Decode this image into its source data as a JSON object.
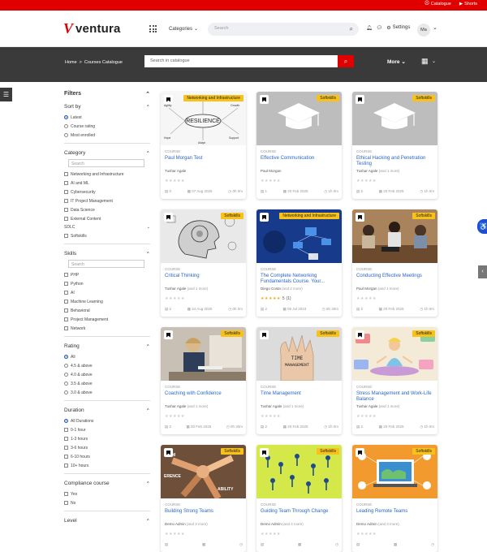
{
  "top_links": {
    "catalogue": "Catalogue",
    "shorts": "Shorts"
  },
  "header": {
    "logo": "ventura",
    "categories": "Categories",
    "search_placeholder": "Search",
    "settings": "Settings",
    "avatar": "Ma"
  },
  "bar": {
    "breadcrumb_home": "Home",
    "breadcrumb_sep": ">",
    "breadcrumb_current": "Courses Catalogue",
    "search_placeholder": "Search in catalogue",
    "more": "More"
  },
  "filters": {
    "title": "Filters",
    "sort": {
      "title": "Sort by",
      "options": [
        "Latest",
        "Course rating",
        "Most enrolled"
      ]
    },
    "category": {
      "title": "Category",
      "placeholder": "Search",
      "options": [
        "Networking and Infrastructure",
        "AI and ML",
        "Cybersecurity",
        "IT Project Management",
        "Data Science",
        "External Content"
      ],
      "sub": "SDLC",
      "sub_options": [
        "Softskills"
      ]
    },
    "skills": {
      "title": "Skills",
      "placeholder": "Search",
      "options": [
        "PHP",
        "Python",
        "AI",
        "Machine Learning",
        "Behavioral",
        "Project Management",
        "Network"
      ]
    },
    "rating": {
      "title": "Rating",
      "options": [
        "All",
        "4.5 & above",
        "4.0 & above",
        "3.5 & above",
        "3.0 & above"
      ]
    },
    "duration": {
      "title": "Duration",
      "options": [
        "All Durations",
        "0-1 hour",
        "1-3 hours",
        "3-6 hours",
        "6-10 hours",
        "10+ hours"
      ]
    },
    "compliance": {
      "title": "Compliance course",
      "options": [
        "Yes",
        "No"
      ]
    },
    "level": {
      "title": "Level"
    }
  },
  "cards": [
    {
      "badge": "Networking and Infrastructure",
      "type": "COURSE",
      "title": "Paul Morgan Test",
      "author": "Tushar Agale",
      "more": "",
      "rating": "",
      "students": "0",
      "date": "07 Aug 2025",
      "duration": "0h 0m",
      "thumb": "resilience"
    },
    {
      "badge": "Softskills",
      "type": "COURSE",
      "title": "Effective Communication",
      "author": "Paul Morgan",
      "more": "",
      "rating": "",
      "students": "1",
      "date": "20 Feb 2025",
      "duration": "1h 0m",
      "thumb": "cap"
    },
    {
      "badge": "Softskills",
      "type": "COURSE",
      "title": "Ethical Hacking and Penetration Testing",
      "author": "Tushar Agale",
      "more": "(and 1 more)",
      "rating": "",
      "students": "2",
      "date": "20 Feb 2025",
      "duration": "1h 0m",
      "thumb": "cap"
    },
    {
      "badge": "Softskills",
      "type": "COURSE",
      "title": "Critical Thinking",
      "author": "Tushar Agale",
      "more": "(and 1 more)",
      "rating": "",
      "students": "2",
      "date": "24 Aug 2025",
      "duration": "0h 0m",
      "thumb": "brain"
    },
    {
      "badge": "Networking and Infrastructure",
      "type": "COURSE",
      "title": "The Complete Networking Fundamentals Course. Your...",
      "author": "Diego Costa",
      "more": "(and 2 more)",
      "rating": "5",
      "rating_count": "(1)",
      "students": "2",
      "date": "05 Jul 2023",
      "duration": "8h 30m",
      "thumb": "network"
    },
    {
      "badge": "Softskills",
      "type": "COURSE",
      "title": "Conducting Effective Meetings",
      "author": "Paul Morgan",
      "more": "(and 1 more)",
      "rating": "",
      "students": "2",
      "date": "20 Feb 2025",
      "duration": "1h 0m",
      "thumb": "meeting"
    },
    {
      "badge": "Softskills",
      "type": "COURSE",
      "title": "Coaching with Confidence",
      "author": "Tushar Agale",
      "more": "(and 1 more)",
      "rating": "",
      "students": "2",
      "date": "20 Feb 2025",
      "duration": "0h 30m",
      "thumb": "coach"
    },
    {
      "badge": "Softskills",
      "type": "COURSE",
      "title": "Time Management",
      "author": "Tushar Agale",
      "more": "(and 1 more)",
      "rating": "",
      "students": "2",
      "date": "20 Feb 2025",
      "duration": "1h 0m",
      "thumb": "time"
    },
    {
      "badge": "Softskills",
      "type": "COURSE",
      "title": "Stress Management and Work-Life Balance",
      "author": "Tushar Agale",
      "more": "(and 1 more)",
      "rating": "",
      "students": "2",
      "date": "20 Feb 2025",
      "duration": "1h 0m",
      "thumb": "stress"
    },
    {
      "badge": "Softskills",
      "type": "COURSE",
      "title": "Building Strong Teams",
      "author": "Demo Admin",
      "more": "(and 3 more)",
      "rating": "",
      "students": "",
      "date": "",
      "duration": "",
      "thumb": "teams"
    },
    {
      "badge": "Softskills",
      "type": "COURSE",
      "title": "Guiding Team Through Change",
      "author": "Demo Admin",
      "more": "(and 4 more)",
      "rating": "",
      "students": "",
      "date": "",
      "duration": "",
      "thumb": "change"
    },
    {
      "badge": "Softskills",
      "type": "COURSE",
      "title": "Leading Remote Teams",
      "author": "Demo Admin",
      "more": "(and 3 more)",
      "rating": "",
      "students": "",
      "date": "",
      "duration": "",
      "thumb": "remote"
    }
  ],
  "colors": {
    "brand": "#e10000",
    "link": "#2a66c9",
    "badge": "#f8c21a",
    "dark": "#3a3a3a"
  }
}
